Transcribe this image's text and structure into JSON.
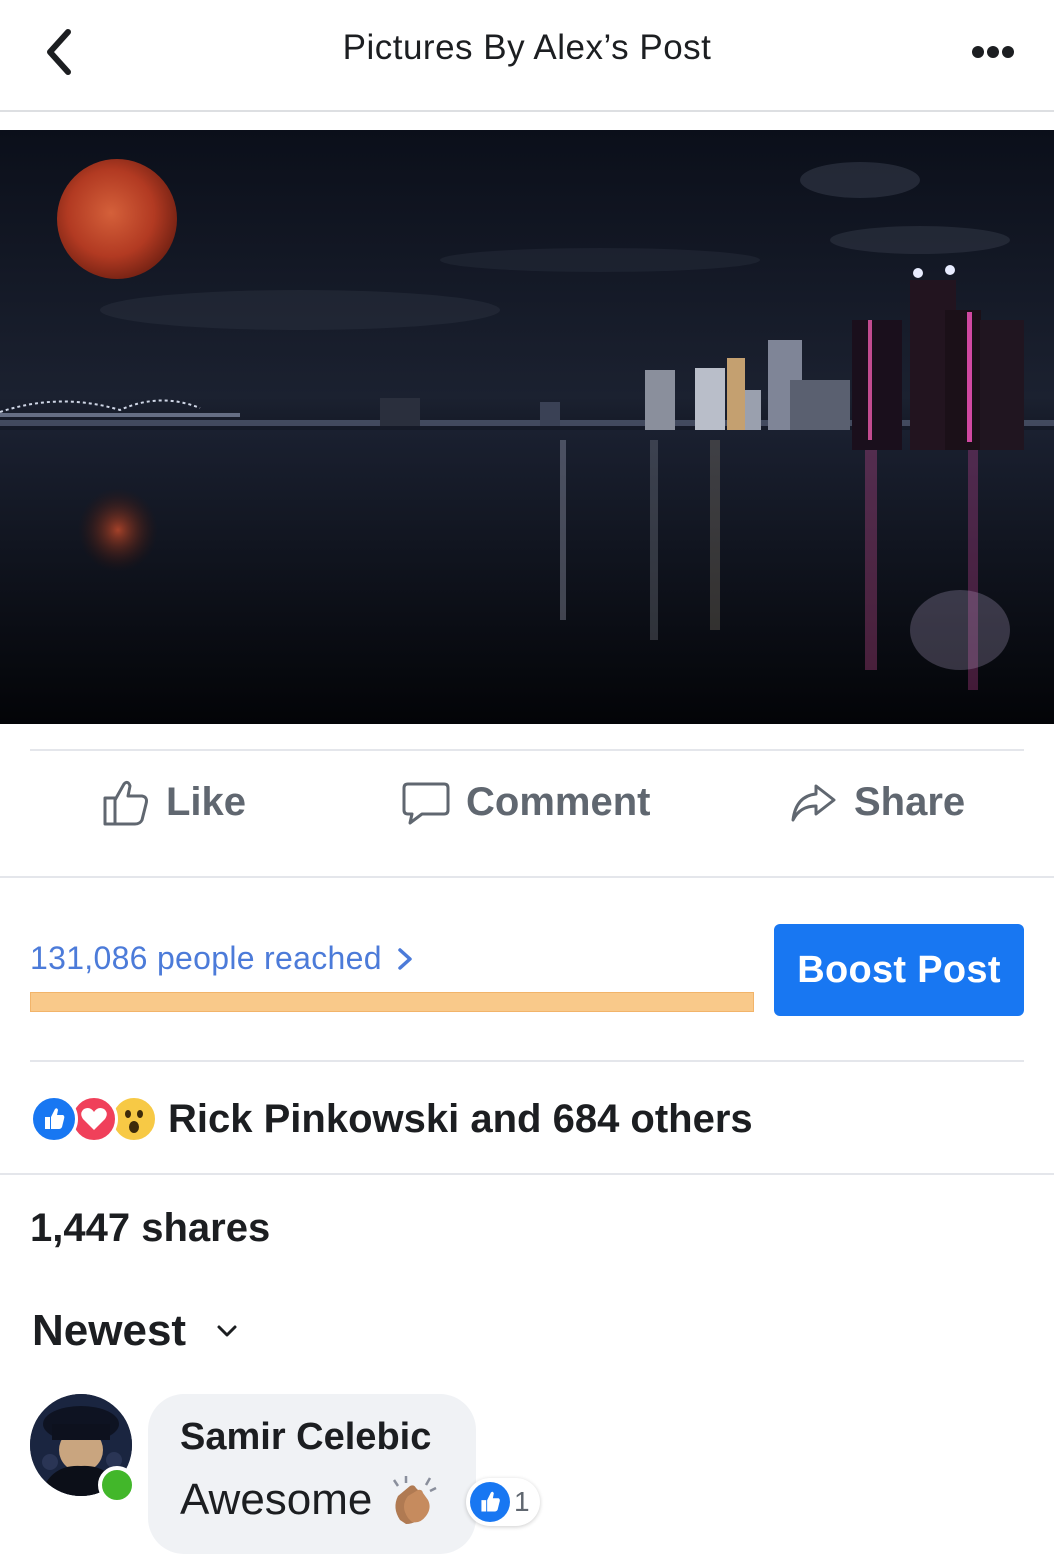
{
  "header": {
    "title": "Pictures By Alex’s Post",
    "back_icon": "chevron-left-icon",
    "more_icon": "more-horizontal-icon"
  },
  "photo": {
    "moon_color": "#c0452a"
  },
  "actions": {
    "like_label": "Like",
    "comment_label": "Comment",
    "share_label": "Share"
  },
  "reach": {
    "text": "131,086 people reached",
    "progress": 1.0,
    "bar_color": "#f9c98a",
    "boost_label": "Boost Post",
    "boost_color": "#1877f2",
    "link_color": "#4c7bd9"
  },
  "reactions": {
    "icons": [
      "like-reaction-icon",
      "love-reaction-icon",
      "wow-reaction-icon"
    ],
    "summary": "Rick Pinkowski and 684 others"
  },
  "shares": {
    "text": "1,447 shares"
  },
  "sort": {
    "selected": "Newest"
  },
  "comments": [
    {
      "author": "Samir Celebic",
      "text": "Awesome",
      "emoji": "clapping-hands",
      "like_count": "1",
      "online": true
    }
  ]
}
